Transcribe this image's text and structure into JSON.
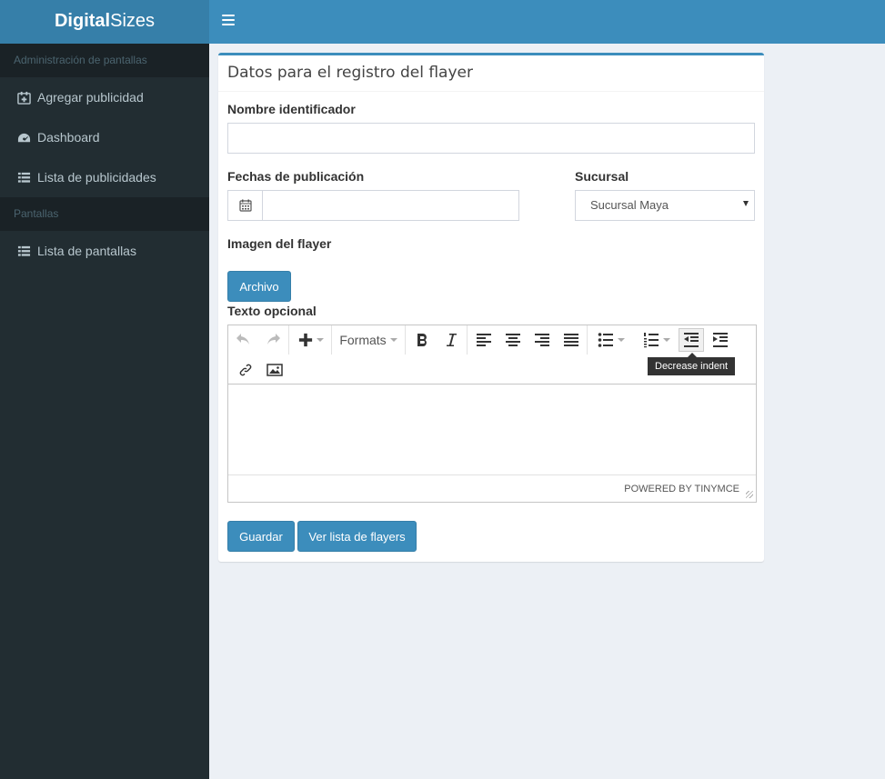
{
  "logo": {
    "bold": "Digital",
    "regular": "Sizes"
  },
  "sidebar": {
    "section1": "Administración de pantallas",
    "items1": [
      {
        "label": "Agregar publicidad",
        "icon": "calendar-plus-icon"
      },
      {
        "label": "Dashboard",
        "icon": "dashboard-icon"
      },
      {
        "label": "Lista de publicidades",
        "icon": "list-icon"
      }
    ],
    "section2": "Pantallas",
    "items2": [
      {
        "label": "Lista de pantallas",
        "icon": "list-icon"
      }
    ]
  },
  "form": {
    "title": "Datos para el registro del flayer",
    "name_label": "Nombre identificador",
    "name_value": "",
    "dates_label": "Fechas de publicación",
    "dates_value": "",
    "branch_label": "Sucursal",
    "branch_value": "Sucursal Maya",
    "image_label": "Imagen del flayer",
    "file_button": "Archivo",
    "text_label": "Texto opcional",
    "save_button": "Guardar",
    "list_button": "Ver lista de flayers"
  },
  "editor": {
    "formats_label": "Formats",
    "powered_by": "POWERED BY TINYMCE",
    "tooltip": "Decrease indent"
  },
  "colors": {
    "primary": "#3c8dbc",
    "sidebar_bg": "#222d32",
    "logo_bg": "#367fa9",
    "content_bg": "#ecf0f5"
  }
}
